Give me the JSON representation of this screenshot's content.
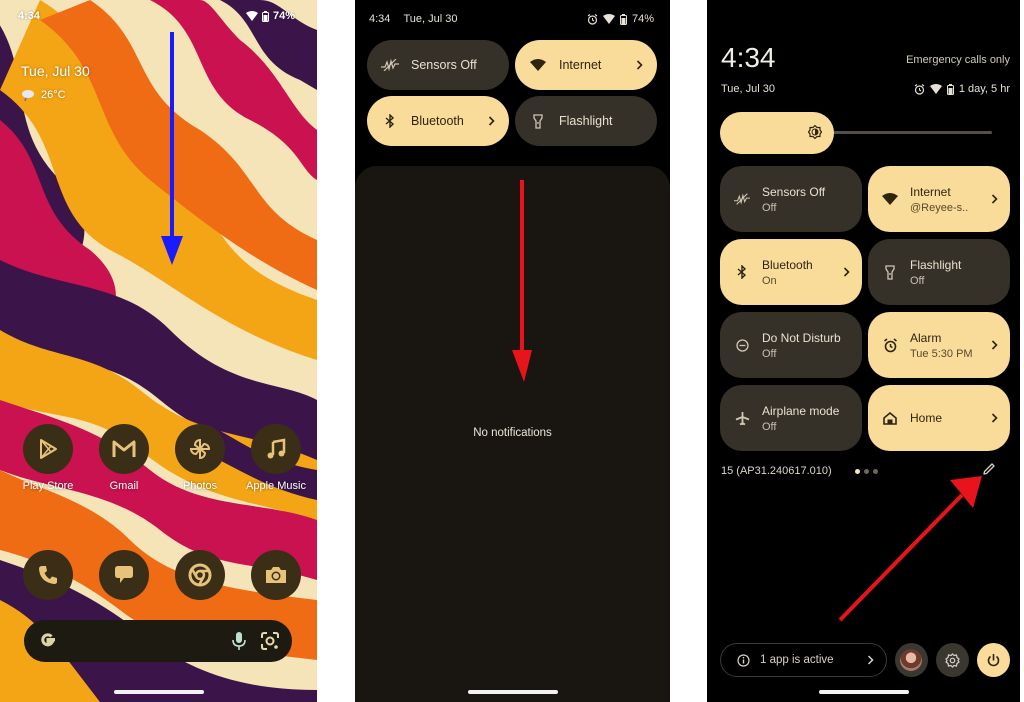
{
  "panels": {
    "home": {
      "status_bar": {
        "time": "4:34",
        "battery": "74%"
      },
      "date": "Tue, Jul 30",
      "weather": {
        "icon": "cloudy-rain-icon",
        "temp": "26°C"
      },
      "apps_row1": [
        {
          "label": "Play Store",
          "icon": "play-store-icon"
        },
        {
          "label": "Gmail",
          "icon": "gmail-icon"
        },
        {
          "label": "Photos",
          "icon": "photos-icon"
        },
        {
          "label": "Apple Music",
          "icon": "music-note-icon"
        }
      ],
      "apps_row2": [
        {
          "label": "Phone",
          "icon": "phone-icon"
        },
        {
          "label": "Messages",
          "icon": "messages-icon"
        },
        {
          "label": "Chrome",
          "icon": "chrome-icon"
        },
        {
          "label": "Camera",
          "icon": "camera-icon"
        }
      ],
      "search_bar": {
        "logo": "G",
        "icons": [
          "mic-icon",
          "lens-icon"
        ]
      },
      "annotation": {
        "type": "arrow",
        "direction": "down",
        "color": "#1a1aff"
      }
    },
    "shade": {
      "status_bar": {
        "time": "4:34",
        "date": "Tue, Jul 30",
        "battery": "74%"
      },
      "tiles": [
        {
          "label": "Sensors Off",
          "state": "off",
          "chevron": false,
          "icon": "sensors-off-icon"
        },
        {
          "label": "Internet",
          "state": "on",
          "chevron": true,
          "icon": "wifi-icon"
        },
        {
          "label": "Bluetooth",
          "state": "on",
          "chevron": true,
          "icon": "bluetooth-icon"
        },
        {
          "label": "Flashlight",
          "state": "off",
          "chevron": false,
          "icon": "flashlight-icon"
        }
      ],
      "empty_message": "No notifications",
      "annotation": {
        "type": "arrow",
        "direction": "down",
        "color": "#e8141b"
      }
    },
    "quick_settings": {
      "clock": "4:34",
      "carrier": "Emergency calls only",
      "date": "Tue, Jul 30",
      "battery_estimate": "1 day, 5 hr",
      "brightness_level": 0.42,
      "tiles": [
        {
          "title": "Sensors Off",
          "subtitle": "Off",
          "state": "off",
          "chevron": false,
          "icon": "sensors-off-icon"
        },
        {
          "title": "Internet",
          "subtitle": "@Reyee-s..",
          "state": "on",
          "chevron": true,
          "icon": "wifi-icon"
        },
        {
          "title": "Bluetooth",
          "subtitle": "On",
          "state": "on",
          "chevron": true,
          "icon": "bluetooth-icon"
        },
        {
          "title": "Flashlight",
          "subtitle": "Off",
          "state": "off",
          "chevron": false,
          "icon": "flashlight-icon"
        },
        {
          "title": "Do Not Disturb",
          "subtitle": "Off",
          "state": "off",
          "chevron": false,
          "icon": "do-not-disturb-icon"
        },
        {
          "title": "Alarm",
          "subtitle": "Tue 5:30 PM",
          "state": "on",
          "chevron": true,
          "icon": "alarm-icon"
        },
        {
          "title": "Airplane mode",
          "subtitle": "Off",
          "state": "off",
          "chevron": false,
          "icon": "airplane-icon"
        },
        {
          "title": "Home",
          "subtitle": "",
          "state": "on",
          "chevron": true,
          "icon": "home-icon"
        }
      ],
      "build_number": "15 (AP31.240617.010)",
      "page_indicator": {
        "pages": 3,
        "current": 1
      },
      "footer": {
        "active_apps": "1 app is active"
      },
      "annotation": {
        "type": "arrow",
        "direction": "up-right",
        "target": "edit-button",
        "color": "#e8141b"
      }
    }
  },
  "colors": {
    "tile_on": "#fadc9a",
    "tile_off": "#353129",
    "shade_bg": "#191510",
    "wallpaper": [
      "#f4e4b8",
      "#f3a516",
      "#ef6b14",
      "#c9124f",
      "#3b154a"
    ]
  }
}
